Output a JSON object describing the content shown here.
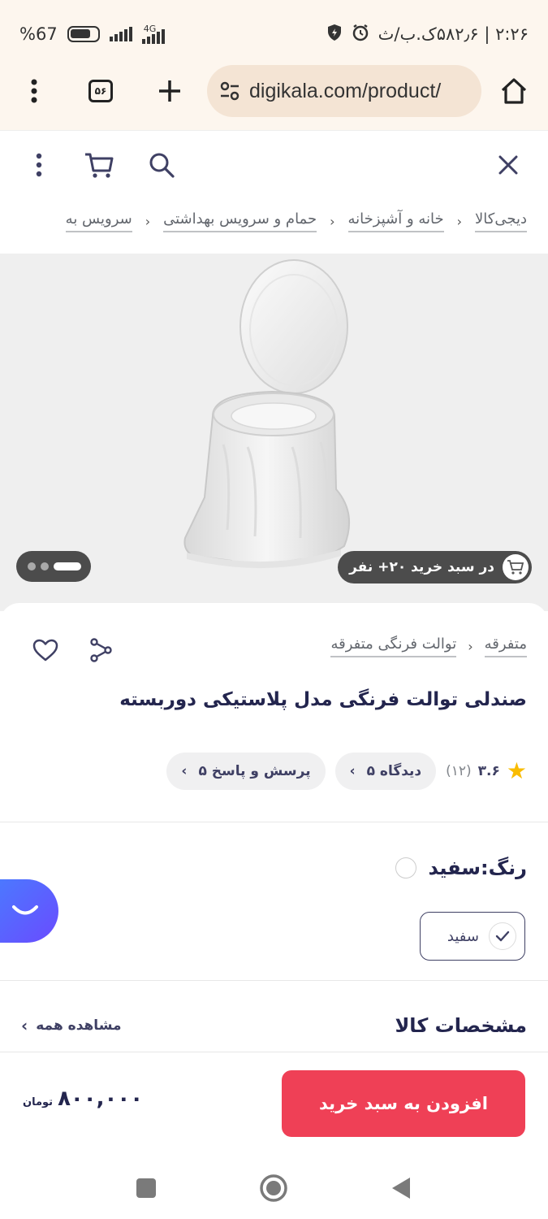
{
  "status_bar": {
    "battery": "67",
    "battery_suffix": "%",
    "network": "4G",
    "time_text": "۲:۲۶ | ۵۸۲٫۶ک.ب/ث"
  },
  "browser": {
    "url": "digikala.com/product/",
    "tab_count": "۵۶"
  },
  "breadcrumb": [
    "دیجی‌کالا",
    "خانه و آشپزخانه",
    "حمام و سرویس بهداشتی",
    "سرویس به"
  ],
  "gallery": {
    "cart_badge": "در سبد خرید ۲۰+ نفر"
  },
  "product": {
    "categories": [
      "متفرقه",
      "توالت فرنگی متفرقه"
    ],
    "title": "صندلی توالت فرنگی مدل پلاستیکی دوربسته",
    "rating": "۳.۶",
    "rating_count": "(۱۲)",
    "reviews_chip": "۵ دیدگاه",
    "qa_chip": "۵ پرسش و پاسخ"
  },
  "color": {
    "label": "رنگ:",
    "selected": "سفید",
    "options": [
      "سفید"
    ]
  },
  "specs": {
    "title": "مشخصات کالا",
    "see_all": "مشاهده همه"
  },
  "buy": {
    "button": "افزودن به سبد خرید",
    "price": "۸۰۰,۰۰۰",
    "currency": "تومان"
  },
  "colors": {
    "accent": "#ef4056",
    "star": "#f9bc00",
    "chrome_bg": "#fdf6ee",
    "chat": "#4a7bff"
  }
}
